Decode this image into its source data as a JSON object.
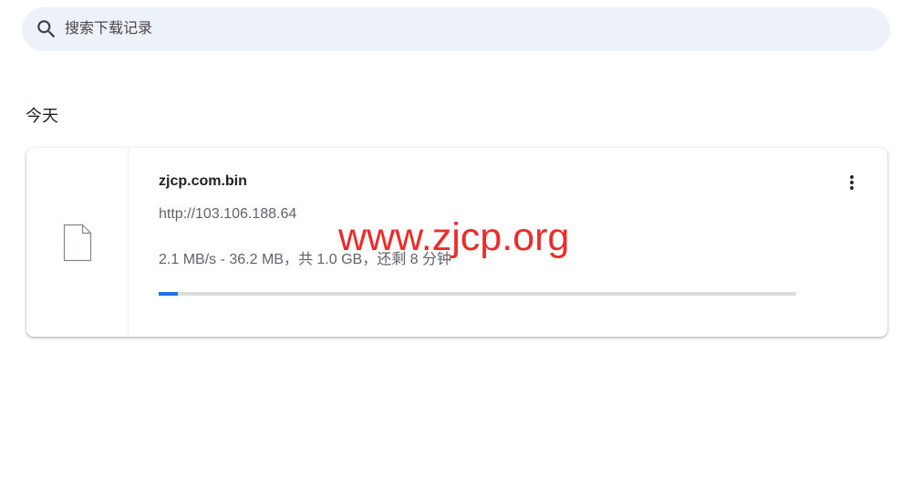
{
  "search": {
    "placeholder": "搜索下载记录",
    "icon": "search-icon"
  },
  "list": {
    "date_group": "今天",
    "items": [
      {
        "file_name": "zjcp.com.bin",
        "url": "http://103.106.188.64",
        "status": "2.1 MB/s - 36.2 MB，共 1.0 GB，还剩 8 分钟",
        "progress": 0.03,
        "file_icon": "file-icon",
        "menu_icon": "more-vert-icon"
      }
    ]
  },
  "watermark": {
    "text": "www.zjcp.org"
  },
  "colors": {
    "accent": "#1a73e8",
    "progress_track": "#dadce0",
    "search_background": "#edf1f9",
    "watermark": "#ee2b2b"
  }
}
